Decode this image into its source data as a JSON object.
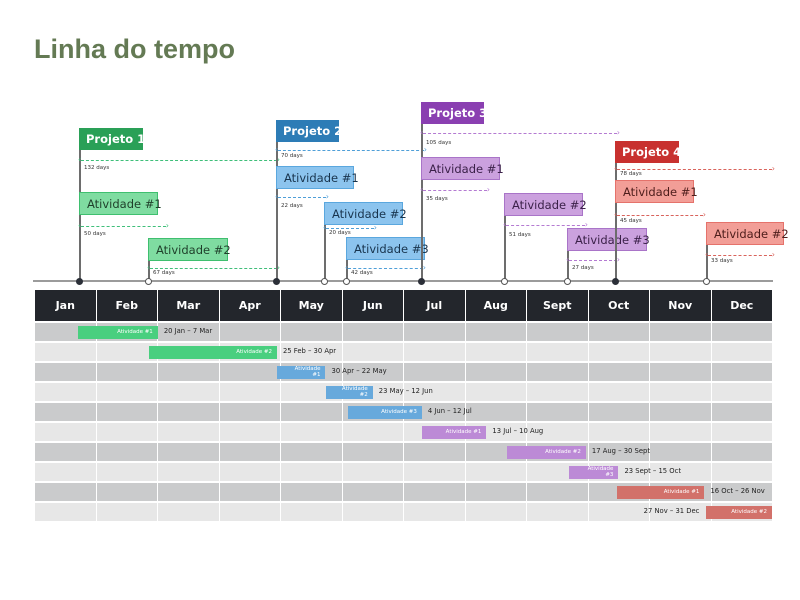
{
  "title": "Linha do tempo",
  "colors": {
    "title": "#647a54",
    "header_bg": "#23262c",
    "row_dark": "#cacbcc",
    "row_light": "#e7e7e7",
    "projects": {
      "p1": {
        "solid": "#2aa057",
        "light": "#7fdca1",
        "border": "#3fbf6f",
        "text": "#1f3f2a",
        "arrow": "#3fbf7a",
        "bar": "#49cf7f"
      },
      "p2": {
        "solid": "#2d7cb6",
        "light": "#8cc4ee",
        "border": "#5aa7de",
        "text": "#18344d",
        "arrow": "#4f9fd8",
        "bar": "#67a9dc"
      },
      "p3": {
        "solid": "#8a3fb1",
        "light": "#cba1de",
        "border": "#a974c8",
        "text": "#3b2149",
        "arrow": "#b47ad2",
        "bar": "#bc8ad6"
      },
      "p4": {
        "solid": "#c8312f",
        "light": "#f29e97",
        "border": "#e5726b",
        "text": "#4d1d1b",
        "arrow": "#d9635c",
        "bar": "#d2716a"
      }
    }
  },
  "months": [
    "Jan",
    "Feb",
    "Mar",
    "Apr",
    "May",
    "Jun",
    "Jul",
    "Aug",
    "Sept",
    "Oct",
    "Nov",
    "Dec"
  ],
  "chart_data": {
    "type": "table",
    "title": "Linha do tempo",
    "axis_months": [
      "Jan",
      "Feb",
      "Mar",
      "Apr",
      "May",
      "Jun",
      "Jul",
      "Aug",
      "Sept",
      "Oct",
      "Nov",
      "Dec"
    ],
    "projects": [
      {
        "name": "Projeto 1",
        "key": "p1",
        "start_month": 0.65,
        "duration_days": 132,
        "activities": [
          {
            "name": "Atividade #1",
            "start_month": 0.65,
            "end_month": 2.23,
            "duration_days": 50,
            "range": "20 Jan – 7 Mar"
          },
          {
            "name": "Atividade #2",
            "start_month": 1.82,
            "end_month": 4.0,
            "duration_days": 67,
            "range": "25 Feb – 30 Apr"
          }
        ]
      },
      {
        "name": "Projeto 2",
        "key": "p2",
        "start_month": 4.0,
        "duration_days": 70,
        "activities": [
          {
            "name": "Atividade #1",
            "start_month": 4.0,
            "end_month": 4.71,
            "duration_days": 22,
            "range": "30 Apr – 22 May"
          },
          {
            "name": "Atividade #2",
            "start_month": 4.74,
            "end_month": 5.4,
            "duration_days": 20,
            "range": "23 May – 12 Jun"
          },
          {
            "name": "Atividade #3",
            "start_month": 5.12,
            "end_month": 6.38,
            "duration_days": 42,
            "range": "4 Jun – 12 Jul"
          }
        ]
      },
      {
        "name": "Projeto 3",
        "key": "p3",
        "start_month": 6.38,
        "duration_days": 105,
        "activities": [
          {
            "name": "Atividade #1",
            "start_month": 6.4,
            "end_month": 7.45,
            "duration_days": 35,
            "range": "13 Jul – 10 Aug"
          },
          {
            "name": "Atividade #2",
            "start_month": 7.76,
            "end_month": 9.0,
            "duration_days": 51,
            "range": "17 Aug – 30 Sept"
          },
          {
            "name": "Atividade #3",
            "start_month": 8.75,
            "end_month": 9.5,
            "duration_days": 27,
            "range": "23 Sept – 15 Oct"
          }
        ]
      },
      {
        "name": "Projeto 4",
        "key": "p4",
        "start_month": 9.5,
        "duration_days": 78,
        "activities": [
          {
            "name": "Atividade #1",
            "start_month": 9.5,
            "end_month": 10.87,
            "duration_days": 45,
            "range": "16 Oct – 26 Nov"
          },
          {
            "name": "Atividade #2",
            "start_month": 10.9,
            "end_month": 12.0,
            "duration_days": 33,
            "range": "27 Nov – 31 Dec"
          }
        ]
      }
    ]
  },
  "gantt_rows": [
    {
      "label": "Atividade #1",
      "label_wrapped": false,
      "project": "p1",
      "start_month": 0.7,
      "end_month": 2.0,
      "range": "20 Jan – 7 Mar",
      "range_side": "right"
    },
    {
      "label": "Atividade #2",
      "label_wrapped": false,
      "project": "p1",
      "start_month": 1.85,
      "end_month": 3.94,
      "range": "25 Feb – 30 Apr",
      "range_side": "right"
    },
    {
      "label": "Atividade #1",
      "label_wrapped": true,
      "project": "p2",
      "start_month": 3.94,
      "end_month": 4.73,
      "range": "30 Apr – 22 May",
      "range_side": "right"
    },
    {
      "label": "Atividade #2",
      "label_wrapped": true,
      "project": "p2",
      "start_month": 4.73,
      "end_month": 5.5,
      "range": "23 May – 12 Jun",
      "range_side": "right"
    },
    {
      "label": "Atividade #3",
      "label_wrapped": false,
      "project": "p2",
      "start_month": 5.1,
      "end_month": 6.3,
      "range": "4 Jun – 12 Jul",
      "range_side": "right"
    },
    {
      "label": "Atividade #1",
      "label_wrapped": false,
      "project": "p3",
      "start_month": 6.3,
      "end_month": 7.35,
      "range": "13 Jul – 10 Aug",
      "range_side": "right"
    },
    {
      "label": "Atividade #2",
      "label_wrapped": false,
      "project": "p3",
      "start_month": 7.68,
      "end_month": 8.97,
      "range": "17 Aug – 30 Sept",
      "range_side": "right"
    },
    {
      "label": "Atividade #3",
      "label_wrapped": true,
      "project": "p3",
      "start_month": 8.7,
      "end_month": 9.5,
      "range": "23 Sept – 15 Oct",
      "range_side": "right"
    },
    {
      "label": "Atividade #1",
      "label_wrapped": false,
      "project": "p4",
      "start_month": 9.47,
      "end_month": 10.9,
      "range": "16 Oct – 26 Nov",
      "range_side": "right"
    },
    {
      "label": "Atividade #2",
      "label_wrapped": false,
      "project": "p4",
      "start_month": 10.92,
      "end_month": 12.0,
      "range": "27 Nov – 31 Dec",
      "range_side": "left"
    }
  ]
}
